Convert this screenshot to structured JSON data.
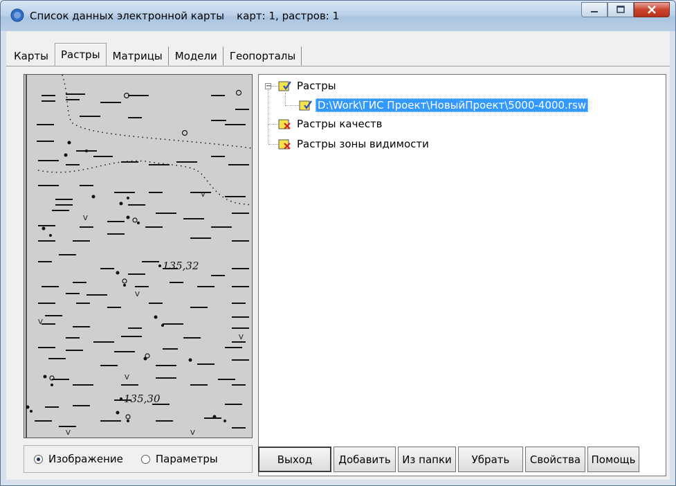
{
  "window": {
    "title": "Список данных электронной карты",
    "status": "карт: 1, растров: 1"
  },
  "tabs": [
    {
      "label": "Карты"
    },
    {
      "label": "Растры"
    },
    {
      "label": "Матрицы"
    },
    {
      "label": "Модели"
    },
    {
      "label": "Геопорталы"
    }
  ],
  "active_tab": "Растры",
  "preview": {
    "elevation_1": "135,32",
    "elevation_2": "135,30"
  },
  "tree": {
    "root_expander": "−",
    "nodes": [
      {
        "label": "Растры",
        "icon": "raster-checked-icon"
      },
      {
        "label": "D:\\Work\\ГИС Проект\\НовыйПроект\\5000-4000.rsw",
        "icon": "raster-checked-icon",
        "selected": true
      },
      {
        "label": "Растры качеств",
        "icon": "raster-crossed-icon"
      },
      {
        "label": "Растры зоны видимости",
        "icon": "raster-crossed-icon"
      }
    ]
  },
  "view_mode": {
    "options": [
      "Изображение",
      "Параметры"
    ],
    "selected": "Изображение"
  },
  "buttons": {
    "exit": "Выход",
    "add": "Добавить",
    "from_folder": "Из папки",
    "remove": "Убрать",
    "properties": "Свойства",
    "help": "Помощь"
  },
  "colors": {
    "selection": "#3399ff",
    "close_button": "#c9442d"
  }
}
